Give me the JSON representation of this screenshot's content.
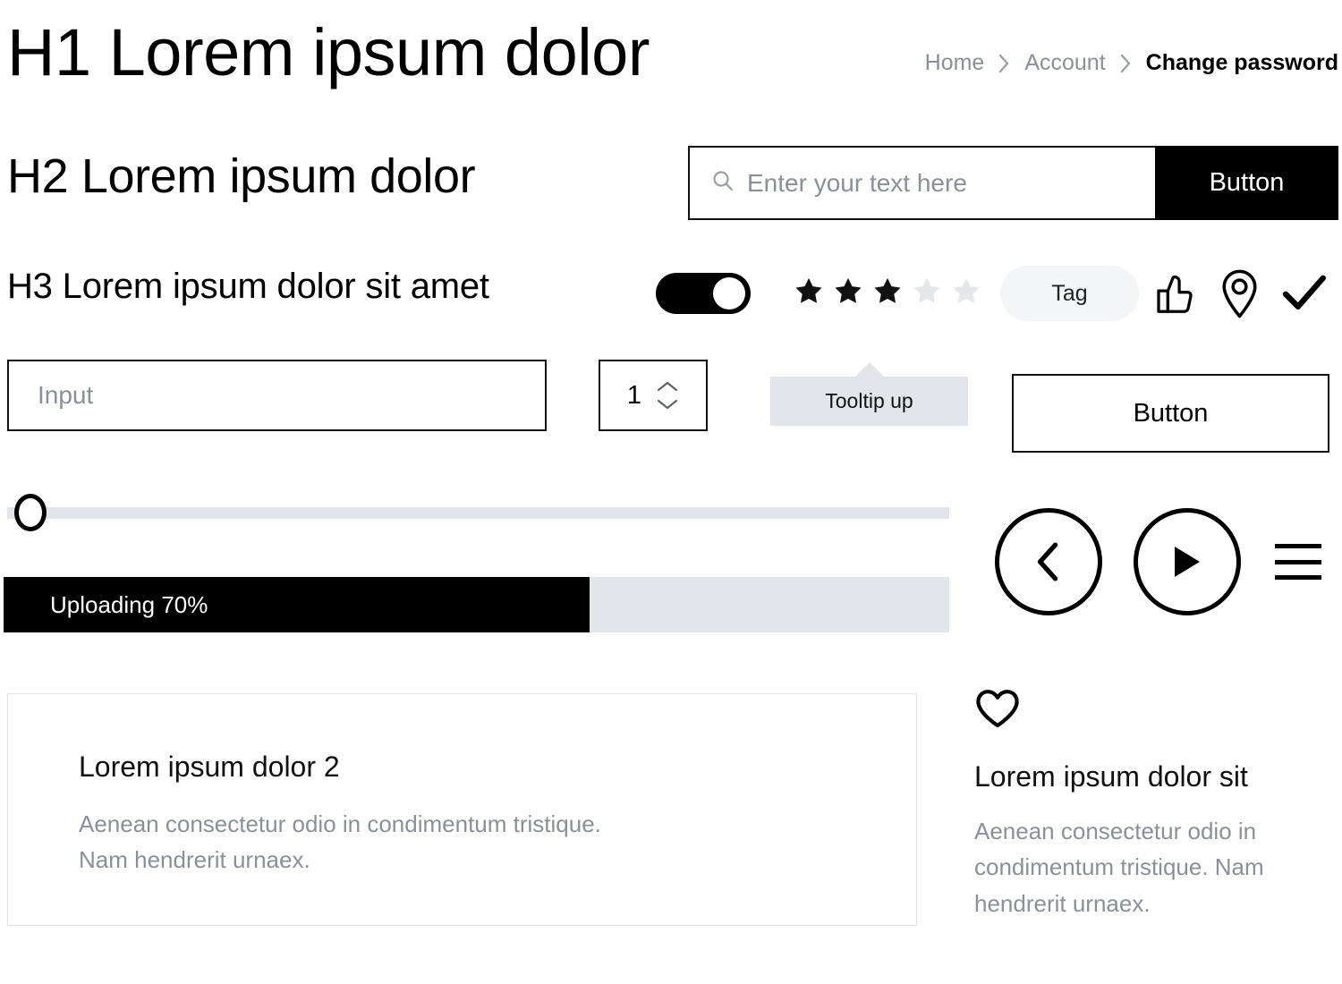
{
  "headings": {
    "h1": "H1 Lorem ipsum dolor",
    "h2": "H2 Lorem ipsum dolor",
    "h3": "H3 Lorem ipsum dolor sit amet"
  },
  "breadcrumb": {
    "items": [
      {
        "label": "Home",
        "current": false
      },
      {
        "label": "Account",
        "current": false
      },
      {
        "label": "Change password",
        "current": true
      }
    ],
    "separator_icon": "chevron-right-icon"
  },
  "search": {
    "icon": "search-icon",
    "placeholder": "Enter your text here",
    "value": "",
    "button_label": "Button"
  },
  "controls": {
    "toggle": {
      "state": "on",
      "icon": "toggle-switch-icon"
    },
    "rating": {
      "filled": 3,
      "total": 5,
      "filled_color": "#111111",
      "empty_color": "#e4e7ea"
    },
    "tag": {
      "label": "Tag",
      "background": "#f4f5f6"
    },
    "icons": [
      {
        "name": "thumbs-up-icon"
      },
      {
        "name": "map-pin-icon"
      },
      {
        "name": "check-icon"
      }
    ]
  },
  "form": {
    "input": {
      "placeholder": "Input",
      "value": ""
    },
    "stepper": {
      "value": "1",
      "up_icon": "chevron-up-icon",
      "down_icon": "chevron-down-icon"
    },
    "tooltip": {
      "text": "Tooltip up",
      "direction": "up",
      "background": "#e2e6ea"
    },
    "secondary_button": {
      "label": "Button"
    }
  },
  "slider": {
    "value": 0,
    "min": 0,
    "max": 100,
    "track_color": "#e2e6ea"
  },
  "progress": {
    "label": "Uploading 70%",
    "percent": 70,
    "fill_width_percent": 62,
    "fill_color": "#000000",
    "track_color": "#e2e6ea"
  },
  "media": {
    "prev_button": {
      "icon": "chevron-left-icon"
    },
    "play_button": {
      "icon": "play-icon"
    },
    "menu_button": {
      "icon": "hamburger-menu-icon"
    }
  },
  "card": {
    "title": "Lorem ipsum dolor 2",
    "body": "Aenean consectetur odio in condimentum tristique. Nam hendrerit urnaex.",
    "border_color": "#dfe1e3"
  },
  "side_block": {
    "icon": "heart-icon",
    "title": "Lorem ipsum dolor sit",
    "body": "Aenean consectetur odio in condimentum tristique. Nam hendrerit urnaex."
  },
  "colors": {
    "text": "#000000",
    "muted": "#8a9099",
    "accent": "#000000",
    "surface": "#e2e6ea"
  }
}
